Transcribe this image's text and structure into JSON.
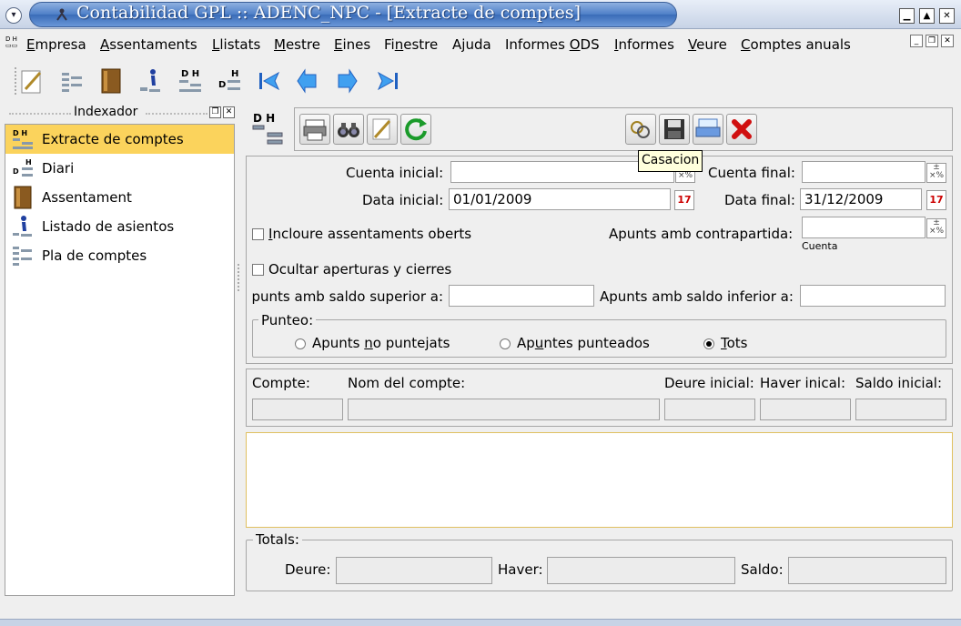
{
  "window": {
    "title": "Contabilidad GPL :: ADENC_NPC - [Extracte de comptes]"
  },
  "menu": [
    {
      "pre": "",
      "u": "E",
      "post": "mpresa"
    },
    {
      "pre": "",
      "u": "A",
      "post": "ssentaments"
    },
    {
      "pre": "",
      "u": "L",
      "post": "listats"
    },
    {
      "pre": "",
      "u": "M",
      "post": "estre"
    },
    {
      "pre": "",
      "u": "E",
      "post": "ines"
    },
    {
      "pre": "Fi",
      "u": "n",
      "post": "estre"
    },
    {
      "pre": "A",
      "u": "j",
      "post": "uda"
    },
    {
      "pre": "Informes ",
      "u": "O",
      "post": "DS"
    },
    {
      "pre": "",
      "u": "I",
      "post": "nformes"
    },
    {
      "pre": "",
      "u": "V",
      "post": "eure"
    },
    {
      "pre": "",
      "u": "C",
      "post": "omptes anuals"
    }
  ],
  "dock": {
    "title": "Indexador",
    "items": [
      "Extracte de comptes",
      "Diari",
      "Assentament",
      "Listado de asientos",
      "Pla de comptes"
    ]
  },
  "tooltip": "Casacion",
  "form": {
    "cuenta_inicial_label": "Cuenta inicial:",
    "cuenta_inicial_value": "",
    "cuenta_final_label": "Cuenta final:",
    "cuenta_final_value": "",
    "data_inicial_label": "Data inicial:",
    "data_inicial_value": "01/01/2009",
    "data_final_label": "Data final:",
    "data_final_value": "31/12/2009",
    "incloure_pre": "",
    "incloure_u": "I",
    "incloure_post": "ncloure assentaments oberts",
    "contrapartida_label": "Apunts amb contrapartida:",
    "contrapartida_value": "",
    "contrapartida_sub": "Cuenta",
    "ocultar_label": "Ocultar aperturas y cierres",
    "saldo_superior_label": "punts amb saldo superior a:",
    "saldo_superior_value": "",
    "saldo_inferior_label": "Apunts amb saldo inferior a:",
    "saldo_inferior_value": "",
    "punteo_label": "Punteo:",
    "radio1_pre": "Apunts ",
    "radio1_u": "n",
    "radio1_post": "o puntejats",
    "radio2_pre": "Ap",
    "radio2_u": "u",
    "radio2_post": "ntes punteados",
    "radio3_pre": "",
    "radio3_u": "T",
    "radio3_post": "ots",
    "selected_radio": "Tots"
  },
  "account_header": {
    "compte": "Compte:",
    "nom": "Nom del compte:",
    "deure_inicial": "Deure inicial:",
    "haver_inicial": "Haver inical:",
    "saldo_inicial": "Saldo inicial:"
  },
  "totals": {
    "title": "Totals:",
    "deure": "Deure:",
    "haver": "Haver:",
    "saldo": "Saldo:"
  },
  "colors": {
    "selection": "#fbd35c",
    "title_blue": "#3a6cb8"
  }
}
